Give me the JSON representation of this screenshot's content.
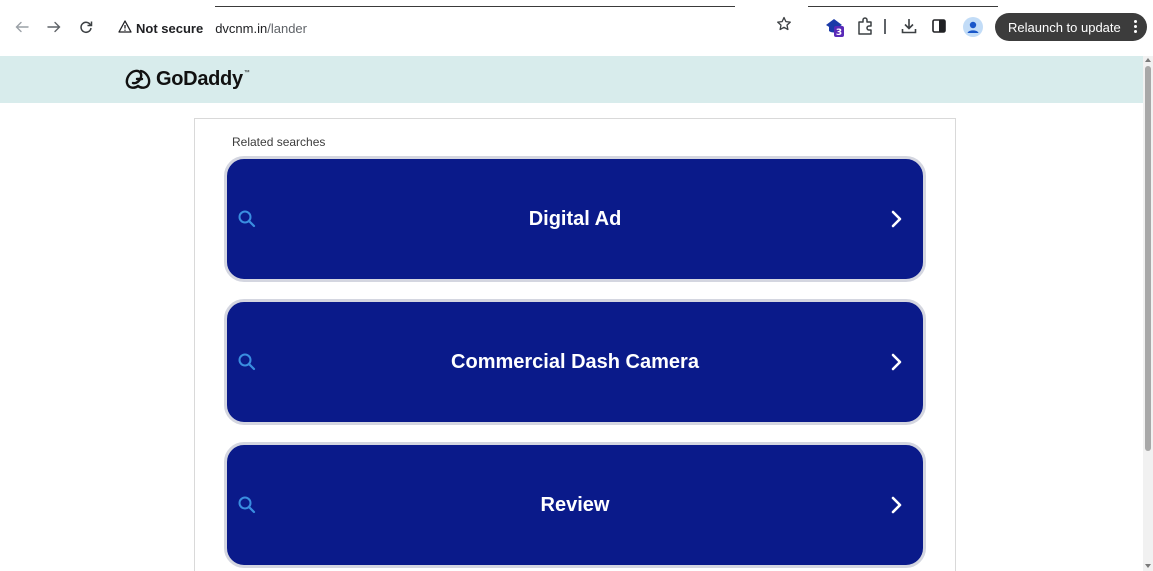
{
  "browser": {
    "security_label": "Not secure",
    "url_host": "dvcnm.in",
    "url_path": "/lander",
    "extension_badge": "3",
    "relaunch_label": "Relaunch to update"
  },
  "page": {
    "logo_text": "GoDaddy",
    "logo_tm": "™",
    "related_label": "Related searches",
    "searches": [
      {
        "label": "Digital Ad"
      },
      {
        "label": "Commercial Dash Camera"
      },
      {
        "label": "Review"
      }
    ]
  },
  "colors": {
    "header_band": "#d8ecec",
    "button_bg": "#0a1a8a",
    "button_icon": "#3a8ee0",
    "relaunch_bg": "#3c3c3c"
  }
}
